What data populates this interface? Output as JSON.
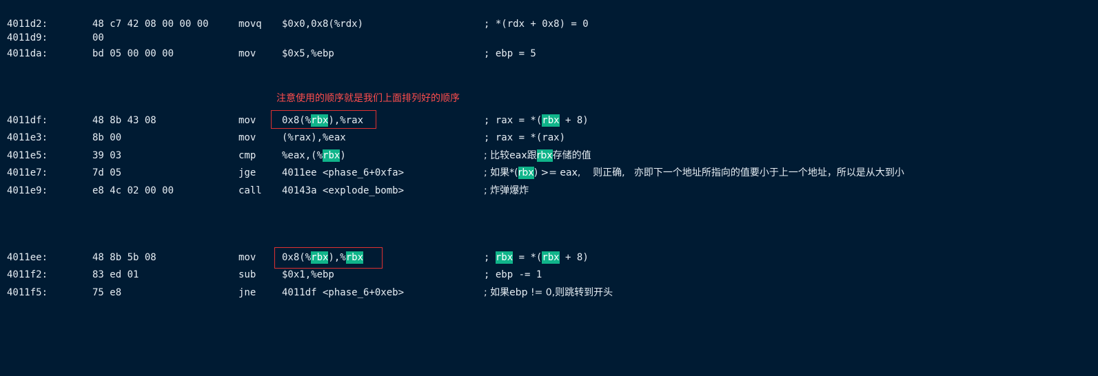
{
  "note": "注意使用的顺序就是我们上面排列好的顺序",
  "lines": {
    "l0": {
      "addr": "4011d2:",
      "bytes": "48 c7 42 08 00 00 00",
      "mn": "movq",
      "op": "$0x0,0x8(%rdx)",
      "cm": "; *(rdx + 0x8) = 0"
    },
    "l1": {
      "addr": "4011d9:",
      "bytes": "00"
    },
    "l2": {
      "addr": "4011da:",
      "bytes": "bd 05 00 00 00",
      "mn": "mov",
      "op": "$0x5,%ebp",
      "cm": "; ebp = 5"
    },
    "l3": {
      "addr": "4011df:",
      "bytes": "48 8b 43 08",
      "mn": "mov",
      "op_a": "0x8(%",
      "op_hl": "rbx",
      "op_b": "),%rax",
      "cm_a": "; rax = *(",
      "cm_hl": "rbx",
      "cm_b": " + 8)"
    },
    "l4": {
      "addr": "4011e3:",
      "bytes": "8b 00",
      "mn": "mov",
      "op": "(%rax),%eax",
      "cm": "; rax = *(rax)"
    },
    "l5": {
      "addr": "4011e5:",
      "bytes": "39 03",
      "mn": "cmp",
      "op_a": "%eax,(%",
      "op_hl": "rbx",
      "op_b": ")",
      "cm_a": "; 比较eax跟",
      "cm_hl": "rbx",
      "cm_b": "存储的值"
    },
    "l6": {
      "addr": "4011e7:",
      "bytes": "7d 05",
      "mn": "jge",
      "op": "4011ee <phase_6+0xfa>",
      "cm_a": "; 如果*(",
      "cm_hl": "rbx",
      "cm_b": ") >= eax,    则正确,   亦即下一个地址所指向的值要小于上一个地址，所以是从大到小"
    },
    "l7": {
      "addr": "4011e9:",
      "bytes": "e8 4c 02 00 00",
      "mn": "call",
      "op": "40143a <explode_bomb>",
      "cm": "; 炸弹爆炸"
    },
    "l8": {
      "addr": "4011ee:",
      "bytes": "48 8b 5b 08",
      "mn": "mov",
      "op_a": "0x8(%",
      "op_hl": "rbx",
      "op_b": "),%",
      "op_hl2": "rbx",
      "cm_a": "; ",
      "cm_hl": "rbx",
      "cm_b": " = *(",
      "cm_hl2": "rbx",
      "cm_c": " + 8)"
    },
    "l9": {
      "addr": "4011f2:",
      "bytes": "83 ed 01",
      "mn": "sub",
      "op": "$0x1,%ebp",
      "cm": "; ebp -= 1"
    },
    "l10": {
      "addr": "4011f5:",
      "bytes": "75 e8",
      "mn": "jne",
      "op": "4011df <phase_6+0xeb>",
      "cm": "; 如果ebp != 0,则跳转到开头"
    }
  },
  "colors": {
    "background": "#001b33",
    "text": "#e6edf3",
    "highlight": "#10b48a",
    "annotation": "#ff4d4d",
    "box_border": "#e03131"
  }
}
